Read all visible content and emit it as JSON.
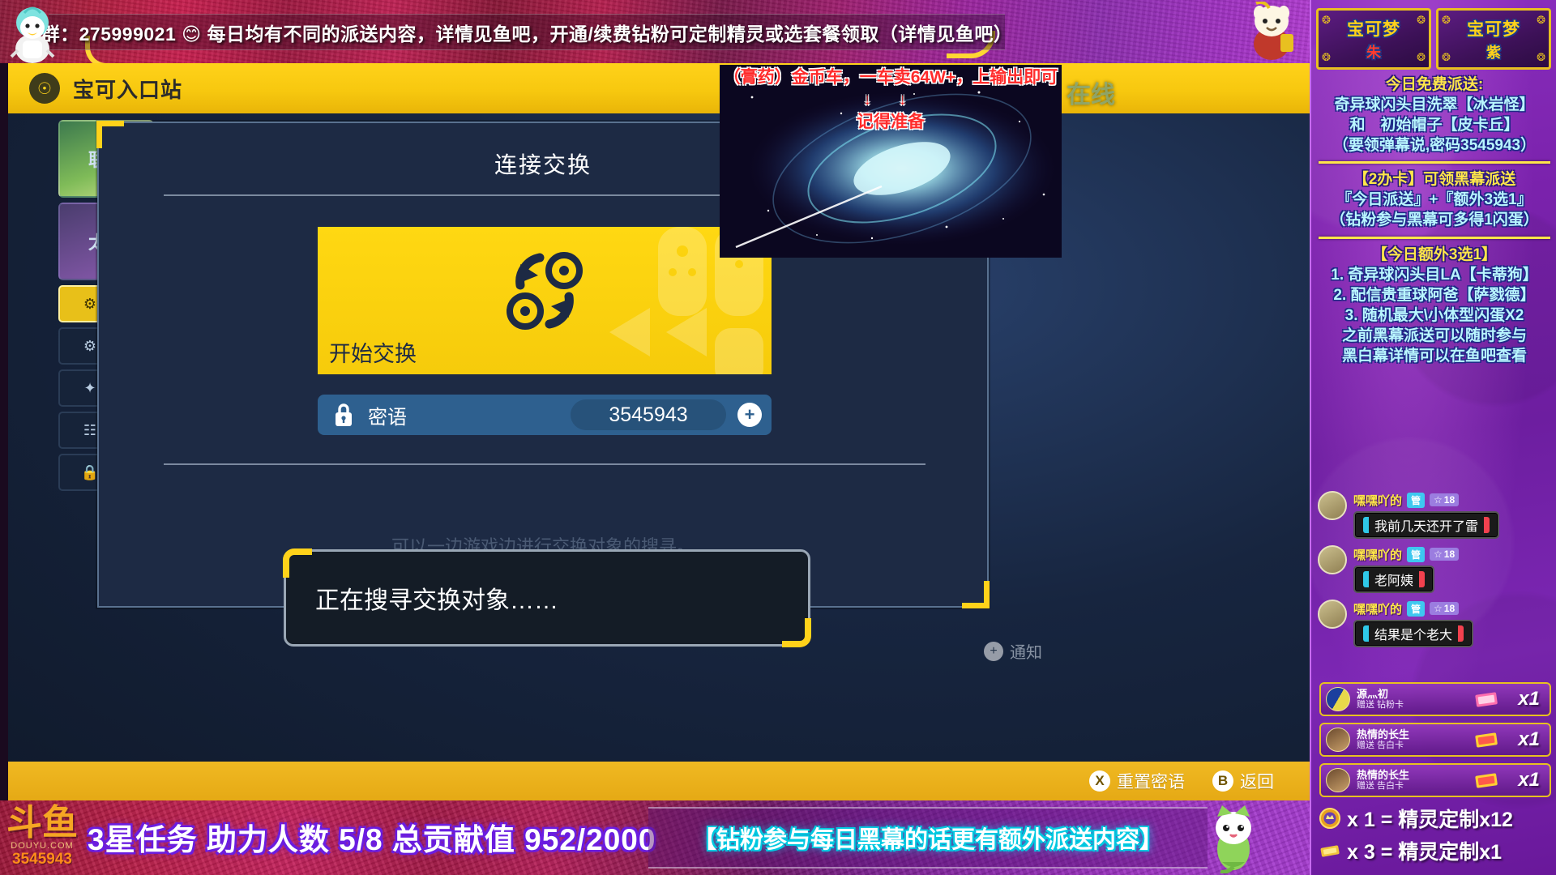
{
  "top_banner": {
    "text": "群：275999021 😊 每日均有不同的派送内容，详情见鱼吧，开通/续费钻粉可定制精灵或选套餐领取（详情见鱼吧）",
    "mascot_left_icon": "duck-mascot-icon",
    "mascot_right_icon": "pokemon-mascot-icon"
  },
  "game": {
    "top_title": "宝可入口站",
    "top_icon": "globe-icon",
    "online_label": "在线",
    "notify_label": "通知",
    "notify_icon": "plus-circle-icon",
    "modal": {
      "title": "连接交换",
      "start_button_label": "开始交换",
      "start_button_icon": "trade-swap-icon",
      "password_label": "密语",
      "password_icon": "lock-icon",
      "password_value": "3545943",
      "password_add_icon": "plus-icon",
      "ghost_text": "可以一边游戏边进行交换对象的搜寻。",
      "searching_text": "正在搜寻交换对象……"
    },
    "bottom_buttons": [
      {
        "key": "X",
        "label": "重置密语"
      },
      {
        "key": "B",
        "label": "返回"
      }
    ],
    "left_nav": [
      {
        "label": "联盟"
      },
      {
        "label": "太晶"
      }
    ]
  },
  "pip_overlay": {
    "line1": "（膏药）金币车，一车卖64W+，上输出即可",
    "arrows": "↓ ↓",
    "line2": "记得准备"
  },
  "bottom_strip": {
    "logo_text": "斗鱼",
    "logo_sub": "DOUYU.COM",
    "room_number": "3545943",
    "mission_text": "3星任务 助力人数 5/8 总贡献值 952/2000",
    "promo_text": "【钻粉参与每日黑幕的话更有额外派送内容】",
    "mascot_icon": "sprigatito-icon"
  },
  "sidebar": {
    "game_cards": [
      {
        "title": "宝可梦",
        "subtitle": "朱"
      },
      {
        "title": "宝可梦",
        "subtitle": "紫"
      }
    ],
    "announcement": {
      "block1": [
        {
          "text": "今日免费派送:",
          "style": "yellow"
        },
        {
          "text": "奇异球闪头目洗翠【冰岩怪】",
          "style": "cyan"
        },
        {
          "text": "和　初始帽子【皮卡丘】",
          "style": "cyan"
        },
        {
          "text": "（要领弹幕说,密码3545943）",
          "style": "cyan"
        }
      ],
      "block2": [
        {
          "text": "【2办卡】可领黑幕派送",
          "style": "yellow"
        },
        {
          "text": "『今日派送』+『额外3选1』",
          "style": "cyan"
        },
        {
          "text": "（钻粉参与黑幕可多得1闪蛋）",
          "style": "cyan"
        }
      ],
      "block3": [
        {
          "text": "【今日额外3选1】",
          "style": "yellow"
        },
        {
          "text": "1. 奇异球闪头目LA【卡蒂狗】",
          "style": "cyan"
        },
        {
          "text": "2. 配信贵重球阿爸【萨戮德】",
          "style": "cyan"
        },
        {
          "text": "3. 随机最大\\小体型闪蛋X2",
          "style": "cyan"
        },
        {
          "text": "之前黑幕派送可以随时参与",
          "style": "cyan"
        },
        {
          "text": "黑白幕详情可以在鱼吧查看",
          "style": "cyan"
        }
      ]
    },
    "chat_messages": [
      {
        "name": "嘿嘿吖的",
        "badge_admin": "管",
        "badge_level": "18",
        "text": "我前几天还开了雷"
      },
      {
        "name": "嘿嘿吖的",
        "badge_admin": "管",
        "badge_level": "18",
        "text": "老阿姨"
      },
      {
        "name": "嘿嘿吖的",
        "badge_admin": "管",
        "badge_level": "18",
        "text": "结果是个老大"
      }
    ],
    "gifts": [
      {
        "user": "源灬初",
        "action": "赠送 钻粉卡",
        "count": "x1",
        "icon": "diamond-fan-card-icon"
      },
      {
        "user": "热情的长生",
        "action": "赠送 告白卡",
        "count": "x1",
        "icon": "confession-card-icon"
      },
      {
        "user": "热情的长生",
        "action": "赠送 告白卡",
        "count": "x1",
        "icon": "confession-card-icon"
      }
    ],
    "rates": [
      {
        "icon": "crown-gift-icon",
        "text": "x 1 = 精灵定制x12"
      },
      {
        "icon": "gold-bar-icon",
        "text": "x 3 = 精灵定制x1"
      }
    ]
  },
  "colors": {
    "accent_yellow": "#ffd21a",
    "sidebar_purple": "#7a22ac",
    "panel_blue": "#1d2a44",
    "alert_red": "#ff2b2b"
  }
}
